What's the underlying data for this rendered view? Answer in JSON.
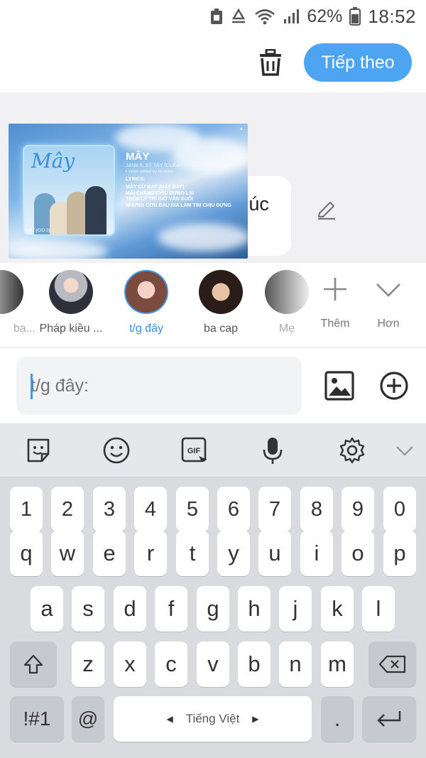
{
  "status_bar": {
    "battery_percent": "62%",
    "time": "18:52",
    "icons": [
      "notification-icon",
      "recycle-icon",
      "wifi-icon",
      "signal-icon",
      "battery-icon"
    ]
  },
  "header": {
    "next_label": "Tiếp theo",
    "delete_icon": "trash-icon"
  },
  "preview": {
    "album_word": "Mây",
    "song_title": "MÂY",
    "artist": "JANK ft. SỸ TÂY (CUKAK REMIX)",
    "editor": "• video edited by tiruxime",
    "lyrics_label": "LYRICS:",
    "lyrics": [
      "MÂY CỨ BAY (MÂY BAY)",
      "MÃI CHẲNG CHỊU DỪNG LẠI",
      "THỎA LÝ TRÍ GIỜ VẪN BUỒI",
      "NHƯNG CƠN ĐAU KIA LÀM TIM CHỊU ĐỰNG"
    ],
    "album_caption": "MÂY (CIO 2)"
  },
  "message": {
    "text": "người chill nhất lúc này"
  },
  "contacts": [
    {
      "name": "bạ...",
      "selected": false,
      "faded": true
    },
    {
      "name": "Pháp kiều ...",
      "selected": false,
      "faded": false
    },
    {
      "name": "t/g đây",
      "selected": true,
      "faded": false
    },
    {
      "name": "ba cap",
      "selected": false,
      "faded": false
    },
    {
      "name": "Mẹ",
      "selected": false,
      "faded": true
    }
  ],
  "strip_actions": {
    "more_label": "Thêm",
    "expand_label": "Hơn"
  },
  "input": {
    "placeholder": "t/g đây:"
  },
  "keyboard": {
    "toolbar": [
      "sticker-icon",
      "emoji-icon",
      "gif-icon",
      "microphone-icon",
      "settings-icon",
      "collapse-chevron-icon"
    ],
    "row_numbers": [
      "1",
      "2",
      "3",
      "4",
      "5",
      "6",
      "7",
      "8",
      "9",
      "0"
    ],
    "row1": [
      "q",
      "w",
      "e",
      "r",
      "t",
      "y",
      "u",
      "i",
      "o",
      "p"
    ],
    "row2": [
      "a",
      "s",
      "d",
      "f",
      "g",
      "h",
      "j",
      "k",
      "l"
    ],
    "row3": [
      "z",
      "x",
      "c",
      "v",
      "b",
      "n",
      "m"
    ],
    "symbols_label": "!#1",
    "at_label": "@",
    "space_label": "Tiếng Việt",
    "period_label": "."
  },
  "colors": {
    "accent": "#4da4f0",
    "selected_text": "#3a8fe0"
  }
}
